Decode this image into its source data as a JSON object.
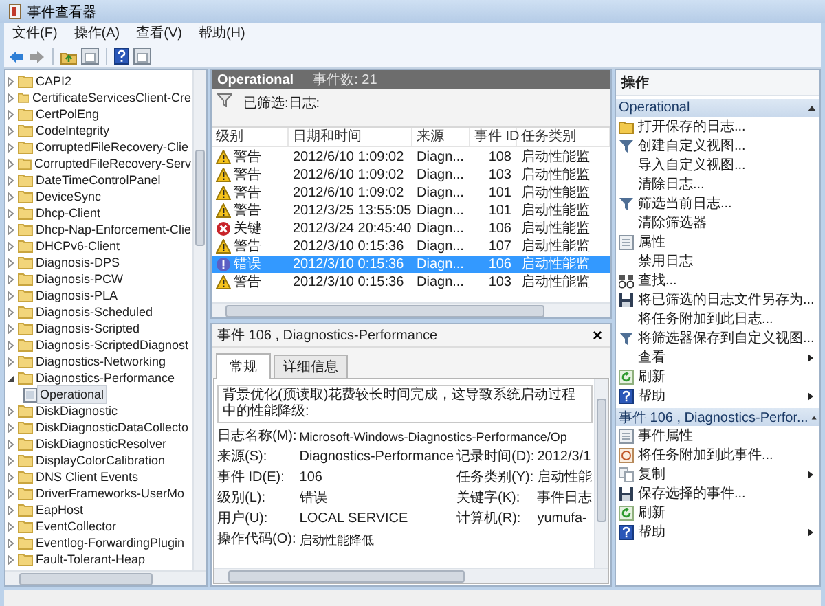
{
  "window": {
    "title": "事件查看器"
  },
  "menu": [
    {
      "label": "文件(F)"
    },
    {
      "label": "操作(A)"
    },
    {
      "label": "查看(V)"
    },
    {
      "label": "帮助(H)"
    }
  ],
  "tree": {
    "items": [
      {
        "kind": "folder",
        "label": "CAPI2",
        "expanded": false,
        "selected": false
      },
      {
        "kind": "folder",
        "label": "CertificateServicesClient-Cre",
        "expanded": false,
        "selected": false
      },
      {
        "kind": "folder",
        "label": "CertPolEng",
        "expanded": false,
        "selected": false
      },
      {
        "kind": "folder",
        "label": "CodeIntegrity",
        "expanded": false,
        "selected": false
      },
      {
        "kind": "folder",
        "label": "CorruptedFileRecovery-Clie",
        "expanded": false,
        "selected": false
      },
      {
        "kind": "folder",
        "label": "CorruptedFileRecovery-Serv",
        "expanded": false,
        "selected": false
      },
      {
        "kind": "folder",
        "label": "DateTimeControlPanel",
        "expanded": false,
        "selected": false
      },
      {
        "kind": "folder",
        "label": "DeviceSync",
        "expanded": false,
        "selected": false
      },
      {
        "kind": "folder",
        "label": "Dhcp-Client",
        "expanded": false,
        "selected": false
      },
      {
        "kind": "folder",
        "label": "Dhcp-Nap-Enforcement-Clie",
        "expanded": false,
        "selected": false
      },
      {
        "kind": "folder",
        "label": "DHCPv6-Client",
        "expanded": false,
        "selected": false
      },
      {
        "kind": "folder",
        "label": "Diagnosis-DPS",
        "expanded": false,
        "selected": false
      },
      {
        "kind": "folder",
        "label": "Diagnosis-PCW",
        "expanded": false,
        "selected": false
      },
      {
        "kind": "folder",
        "label": "Diagnosis-PLA",
        "expanded": false,
        "selected": false
      },
      {
        "kind": "folder",
        "label": "Diagnosis-Scheduled",
        "expanded": false,
        "selected": false
      },
      {
        "kind": "folder",
        "label": "Diagnosis-Scripted",
        "expanded": false,
        "selected": false
      },
      {
        "kind": "folder",
        "label": "Diagnosis-ScriptedDiagnost",
        "expanded": false,
        "selected": false
      },
      {
        "kind": "folder",
        "label": "Diagnostics-Networking",
        "expanded": false,
        "selected": false
      },
      {
        "kind": "folder",
        "label": "Diagnostics-Performance",
        "expanded": true,
        "selected": false,
        "children": [
          {
            "kind": "log",
            "label": "Operational",
            "selected": true
          }
        ]
      },
      {
        "kind": "folder",
        "label": "DiskDiagnostic",
        "expanded": false,
        "selected": false
      },
      {
        "kind": "folder",
        "label": "DiskDiagnosticDataCollecto",
        "expanded": false,
        "selected": false
      },
      {
        "kind": "folder",
        "label": "DiskDiagnosticResolver",
        "expanded": false,
        "selected": false
      },
      {
        "kind": "folder",
        "label": "DisplayColorCalibration",
        "expanded": false,
        "selected": false
      },
      {
        "kind": "folder",
        "label": "DNS Client Events",
        "expanded": false,
        "selected": false
      },
      {
        "kind": "folder",
        "label": "DriverFrameworks-UserMo",
        "expanded": false,
        "selected": false
      },
      {
        "kind": "folder",
        "label": "EapHost",
        "expanded": false,
        "selected": false
      },
      {
        "kind": "folder",
        "label": "EventCollector",
        "expanded": false,
        "selected": false
      },
      {
        "kind": "folder",
        "label": "Eventlog-ForwardingPlugin",
        "expanded": false,
        "selected": false
      },
      {
        "kind": "folder",
        "label": "Fault-Tolerant-Heap",
        "expanded": false,
        "selected": false
      }
    ]
  },
  "log": {
    "title": "Operational",
    "count": "事件数: 21",
    "filter": "已筛选:日志:"
  },
  "table": {
    "columns": [
      "级别",
      "日期和时间",
      "来源",
      "事件 ID",
      "任务类别"
    ],
    "rows": [
      {
        "kind": "warning",
        "level": "警告",
        "datetime": "2012/6/10 1:09:02",
        "source": "Diagn...",
        "event_id": "108",
        "task": "启动性能监",
        "selected": false
      },
      {
        "kind": "warning",
        "level": "警告",
        "datetime": "2012/6/10 1:09:02",
        "source": "Diagn...",
        "event_id": "103",
        "task": "启动性能监",
        "selected": false
      },
      {
        "kind": "warning",
        "level": "警告",
        "datetime": "2012/6/10 1:09:02",
        "source": "Diagn...",
        "event_id": "101",
        "task": "启动性能监",
        "selected": false
      },
      {
        "kind": "warning",
        "level": "警告",
        "datetime": "2012/3/25 13:55:05",
        "source": "Diagn...",
        "event_id": "101",
        "task": "启动性能监",
        "selected": false
      },
      {
        "kind": "critical",
        "level": "关键",
        "datetime": "2012/3/24 20:45:40",
        "source": "Diagn...",
        "event_id": "106",
        "task": "启动性能监",
        "selected": false
      },
      {
        "kind": "warning",
        "level": "警告",
        "datetime": "2012/3/10 0:15:36",
        "source": "Diagn...",
        "event_id": "107",
        "task": "启动性能监",
        "selected": false
      },
      {
        "kind": "error",
        "level": "错误",
        "datetime": "2012/3/10 0:15:36",
        "source": "Diagn...",
        "event_id": "106",
        "task": "启动性能监",
        "selected": true
      },
      {
        "kind": "warning",
        "level": "警告",
        "datetime": "2012/3/10 0:15:36",
        "source": "Diagn...",
        "event_id": "103",
        "task": "启动性能监",
        "selected": false
      }
    ]
  },
  "detail": {
    "title": "事件 106 , Diagnostics-Performance",
    "close": "×",
    "tabs": [
      {
        "label": "常规",
        "selected": true
      },
      {
        "label": "详细信息",
        "selected": false
      }
    ],
    "description": "背景优化(预读取)花费较长时间完成，这导致系统启动过程中的性能降级:",
    "fields": [
      {
        "label": "日志名称(M):",
        "value": "Microsoft-Windows-Diagnostics-Performance/Op"
      },
      {
        "label": "来源(S):",
        "value": "Diagnostics-Performance",
        "label_2": "记录时间(D):",
        "value_2": "2012/3/1"
      },
      {
        "label": "事件 ID(E):",
        "value": "106",
        "label_2": "任务类别(Y):",
        "value_2": "启动性能"
      },
      {
        "label": "级别(L):",
        "value": "错误",
        "label_2": "关键字(K):",
        "value_2": "事件日志"
      },
      {
        "label": "用户(U):",
        "value": "LOCAL SERVICE",
        "label_2": "计算机(R):",
        "value_2": "yumufa-"
      },
      {
        "label": "操作代码(O):",
        "value": "启动性能降低"
      }
    ]
  },
  "actions": {
    "title": "操作",
    "sections": [
      {
        "title": "Operational",
        "expanded": true,
        "items": [
          {
            "kind": "open",
            "label": "打开保存的日志...",
            "submenu": false
          },
          {
            "kind": "filter",
            "label": "创建自定义视图...",
            "submenu": false
          },
          {
            "kind": "none",
            "label": "导入自定义视图...",
            "submenu": false
          },
          {
            "kind": "none",
            "label": "清除日志...",
            "submenu": false
          },
          {
            "kind": "filter",
            "label": "筛选当前日志...",
            "submenu": false
          },
          {
            "kind": "none",
            "label": "清除筛选器",
            "submenu": false
          },
          {
            "kind": "properties",
            "label": "属性",
            "submenu": false
          },
          {
            "kind": "none",
            "label": "禁用日志",
            "submenu": false
          },
          {
            "kind": "find",
            "label": "查找...",
            "submenu": false
          },
          {
            "kind": "save",
            "label": "将已筛选的日志文件另存为...",
            "submenu": false
          },
          {
            "kind": "none",
            "label": "将任务附加到此日志...",
            "submenu": false
          },
          {
            "kind": "filter",
            "label": "将筛选器保存到自定义视图...",
            "submenu": false
          },
          {
            "kind": "none",
            "label": "查看",
            "submenu": true
          },
          {
            "kind": "refresh",
            "label": "刷新",
            "submenu": false
          },
          {
            "kind": "help",
            "label": "帮助",
            "submenu": true
          }
        ]
      },
      {
        "title": "事件 106 , Diagnostics-Perfor...",
        "expanded": true,
        "items": [
          {
            "kind": "properties",
            "label": "事件属性",
            "submenu": false
          },
          {
            "kind": "task",
            "label": "将任务附加到此事件...",
            "submenu": false
          },
          {
            "kind": "copy",
            "label": "复制",
            "submenu": true
          },
          {
            "kind": "save",
            "label": "保存选择的事件...",
            "submenu": false
          },
          {
            "kind": "refresh",
            "label": "刷新",
            "submenu": false
          },
          {
            "kind": "help",
            "label": "帮助",
            "submenu": true
          }
        ]
      }
    ]
  }
}
